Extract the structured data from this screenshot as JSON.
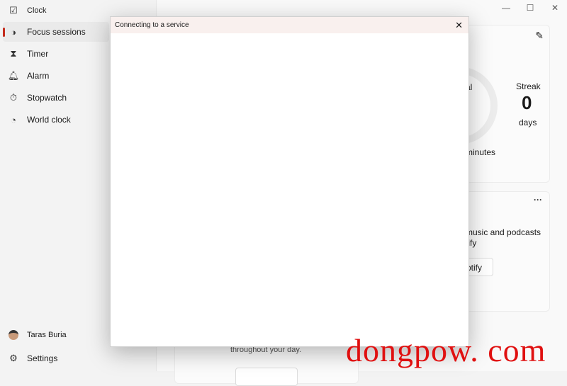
{
  "app": {
    "title": "Clock"
  },
  "sidebar": {
    "items": [
      {
        "label": "Focus sessions",
        "icon": "focus-icon",
        "active": true
      },
      {
        "label": "Timer",
        "icon": "hourglass-icon"
      },
      {
        "label": "Alarm",
        "icon": "bell-icon"
      },
      {
        "label": "Stopwatch",
        "icon": "stopwatch-icon"
      },
      {
        "label": "World clock",
        "icon": "globe-icon"
      }
    ],
    "user": "Taras Buria",
    "settings": "Settings"
  },
  "main": {
    "progress": {
      "daily_goal_partial": "al",
      "minutes_partial": "minutes",
      "streak_label": "Streak",
      "streak_value": "0",
      "streak_unit": "days"
    },
    "spotify": {
      "text_line1": "music and podcasts",
      "text_line2": "tify",
      "button_partial": "otify"
    },
    "tasks": {
      "text": "throughout your day."
    }
  },
  "dialog": {
    "title": "Connecting to a service",
    "close": "✕"
  },
  "watermark": "dongpow. com",
  "colors": {
    "accent": "#c42b1c",
    "dialog_header": "#f9f0ee",
    "watermark": "#e01010"
  }
}
